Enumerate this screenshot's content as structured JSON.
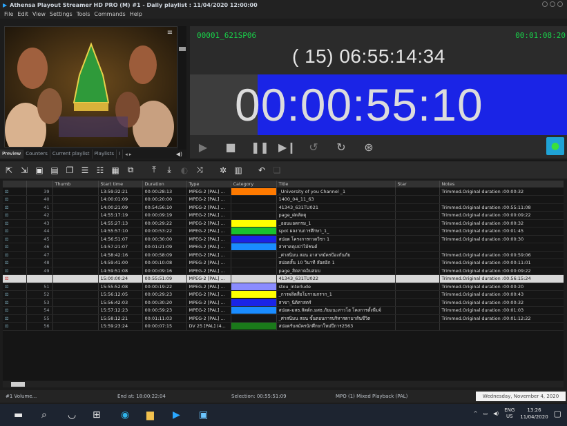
{
  "window": {
    "title": "Athensa Playout Streamer HD PRO (M) #1 - Daily playlist : 11/04/2020 12:00:00"
  },
  "menu": [
    "File",
    "Edit",
    "View",
    "Settings",
    "Tools",
    "Commands",
    "Help"
  ],
  "tabs": [
    "Preview",
    "Counters",
    "Current playlist",
    "Playlists",
    "I"
  ],
  "player": {
    "clip_name": "00001_621SP06",
    "clip_timecode": "00:01:08:20",
    "elapsed": "( 15) 06:55:14:34",
    "remaining": "00:00:55:10",
    "remaining_progress": 0.82
  },
  "colors": {
    "accent_blue": "#1a24e6",
    "timecode_green": "#19d24a"
  },
  "grid": {
    "headers": [
      "",
      "",
      "Thumb",
      "Start time",
      "Duration",
      "Type",
      "Category",
      "Title",
      "Star",
      "Notes"
    ],
    "rows": [
      {
        "n": "39",
        "start": "13:59:32:21",
        "dur": "00:00:28:13",
        "type": "MPEG-2 [PAL] ...",
        "cat": "#ff7a00",
        "title": "_University of you Channel _1",
        "notes": "Trimmed.Original duration :00:00:32"
      },
      {
        "n": "40",
        "start": "14:00:01:09",
        "dur": "00:00:20:00",
        "type": "MPEG-2 [PAL] ...",
        "cat": "",
        "title": "1400_04_11_63",
        "notes": ""
      },
      {
        "n": "41",
        "start": "14:00:21:09",
        "dur": "00:54:56:10",
        "type": "MPEG-2 [PAL] ...",
        "cat": "",
        "title": "41343_631TU021",
        "notes": "Trimmed.Original duration :00:55:11:08"
      },
      {
        "n": "42",
        "start": "14:55:17:19",
        "dur": "00:00:09:19",
        "type": "MPEG-2 [PAL] ...",
        "cat": "",
        "title": "page_ฝดลัดดุ",
        "notes": "Trimmed.Original duration :00:00:09:22"
      },
      {
        "n": "43",
        "start": "14:55:27:13",
        "dur": "00:00:29:22",
        "type": "MPEG-2 [PAL] ...",
        "cat": "#ffff00",
        "title": "_ออนแอดกรม_1",
        "notes": "Trimmed.Original duration :00:00:32"
      },
      {
        "n": "44",
        "start": "14:55:57:10",
        "dur": "00:00:53:22",
        "type": "MPEG-2 [PAL] ...",
        "cat": "#19c22e",
        "title": "spot ผลงานการศึกษา_1_",
        "notes": "Trimmed.Original duration :00:01:45"
      },
      {
        "n": "45",
        "start": "14:56:51:07",
        "dur": "00:00:30:00",
        "type": "MPEG-2 [PAL] ...",
        "cat": "#1a24e6",
        "title": "สปอต โครงการกวดวิชา 1",
        "notes": "Trimmed.Original duration :00:00:30"
      },
      {
        "n": "46",
        "start": "14:57:21:07",
        "dur": "00:01:21:09",
        "type": "MPEG-2 [PAL] ...",
        "cat": "#1a8cff",
        "title": "สาราคดุมป่าไม้ชนด์",
        "notes": ""
      },
      {
        "n": "47",
        "start": "14:58:42:16",
        "dur": "00:00:58:09",
        "type": "MPEG-2 [PAL] ...",
        "cat": "",
        "title": "_ศาสนิมน สอน อาสาสมัครป้องกันภัย",
        "notes": "Trimmed.Original duration :00:00:59:06"
      },
      {
        "n": "48",
        "start": "14:59:41:00",
        "dur": "00:00:10:08",
        "type": "MPEG-2 [PAL] ...",
        "cat": "",
        "title": "สปอตสั้น 10 วินาที ล๊อตอิก 1",
        "notes": "Trimmed.Original duration :00:00:11:01"
      },
      {
        "n": "49",
        "start": "14:59:51:08",
        "dur": "00:00:09:16",
        "type": "MPEG-2 [PAL] ...",
        "cat": "",
        "title": "page_สิตลาคอินสมบ",
        "notes": "Trimmed.Original duration :00:00:09:22"
      },
      {
        "n": "",
        "start": "15:00:00:24",
        "dur": "00:55:51:09",
        "type": "MPEG-2 [PAL] ...",
        "cat": "",
        "title": "41343_631TU022",
        "notes": "Trimmed.Original duration :00:56:15:24",
        "selected": true
      },
      {
        "n": "51",
        "start": "15:55:52:08",
        "dur": "00:00:19:22",
        "type": "MPEG-2 [PAL] ...",
        "cat": "#8a8cff",
        "title": "stou_interlude",
        "notes": "Trimmed.Original duration :00:00:20"
      },
      {
        "n": "52",
        "start": "15:56:12:05",
        "dur": "00:00:29:23",
        "type": "MPEG-2 [PAL] ...",
        "cat": "#ffff00",
        "title": "_การผลิตสื่อโบราณกราก_1",
        "notes": "Trimmed.Original duration :00:00:43"
      },
      {
        "n": "53",
        "start": "15:56:42:03",
        "dur": "00:00:30:20",
        "type": "MPEG-2 [PAL] ...",
        "cat": "#1a24e6",
        "title": "สาขา_นิติศาสตร์",
        "notes": "Trimmed.Original duration :00:00:32"
      },
      {
        "n": "54",
        "start": "15:57:12:23",
        "dur": "00:00:59:23",
        "type": "MPEG-2 [PAL] ...",
        "cat": "#1a8cff",
        "title": "สปอต-มสธ.สัตต์ก.มสธ.ภัยแนะสาวโฮ โคงการตั้งพีมจ์",
        "notes": "Trimmed.Original duration :00:01:03"
      },
      {
        "n": "55",
        "start": "15:58:12:21",
        "dur": "00:01:11:03",
        "type": "MPEG-2 [PAL] ...",
        "cat": "",
        "title": "_ศาสนิมน สอน ขั้นตอนการบริหารตามาสันชีวิต",
        "notes": "Trimmed.Original duration :00:01:12:22"
      },
      {
        "n": "56",
        "start": "15:59:23:24",
        "dur": "00:00:07:15",
        "type": "DV 25 [PAL] (4...",
        "cat": "#1a7a1a",
        "title": "สปอตรับสมัครนักศึกษาใหม่ปีการ2563",
        "notes": ""
      }
    ]
  },
  "status": {
    "volume": "#1 Volume...",
    "end_at": "End at: 18:00:22:04",
    "selection": "Selection: 00:55:51:09",
    "mpo": "MPO (1) Mixed Playback (PAL)",
    "date_tooltip": "Wednesday, November 4, 2020"
  },
  "tray": {
    "lang_top": "ENG",
    "lang_bottom": "US",
    "time": "13:26",
    "date": "11/04/2020"
  }
}
